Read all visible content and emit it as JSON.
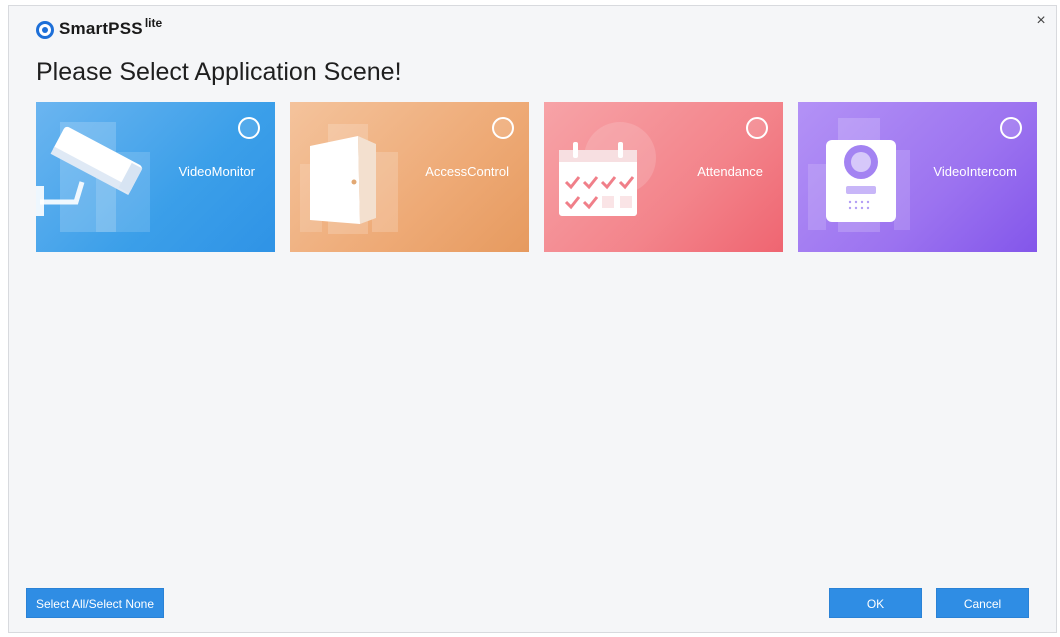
{
  "app": {
    "logo_text": "SmartPSS",
    "logo_superscript": "lite",
    "close_glyph": "×"
  },
  "heading": "Please Select Application Scene!",
  "scenes": [
    {
      "label": "VideoMonitor",
      "icon": "camera-icon",
      "selected": false,
      "color": "#3b9fe9"
    },
    {
      "label": "AccessControl",
      "icon": "door-icon",
      "selected": false,
      "color": "#eeaa76"
    },
    {
      "label": "Attendance",
      "icon": "calendar-icon",
      "selected": false,
      "color": "#f3848b"
    },
    {
      "label": "VideoIntercom",
      "icon": "intercom-icon",
      "selected": false,
      "color": "#9c73f0"
    }
  ],
  "footer": {
    "select_all_label": "Select All/Select None",
    "ok_label": "OK",
    "cancel_label": "Cancel"
  }
}
